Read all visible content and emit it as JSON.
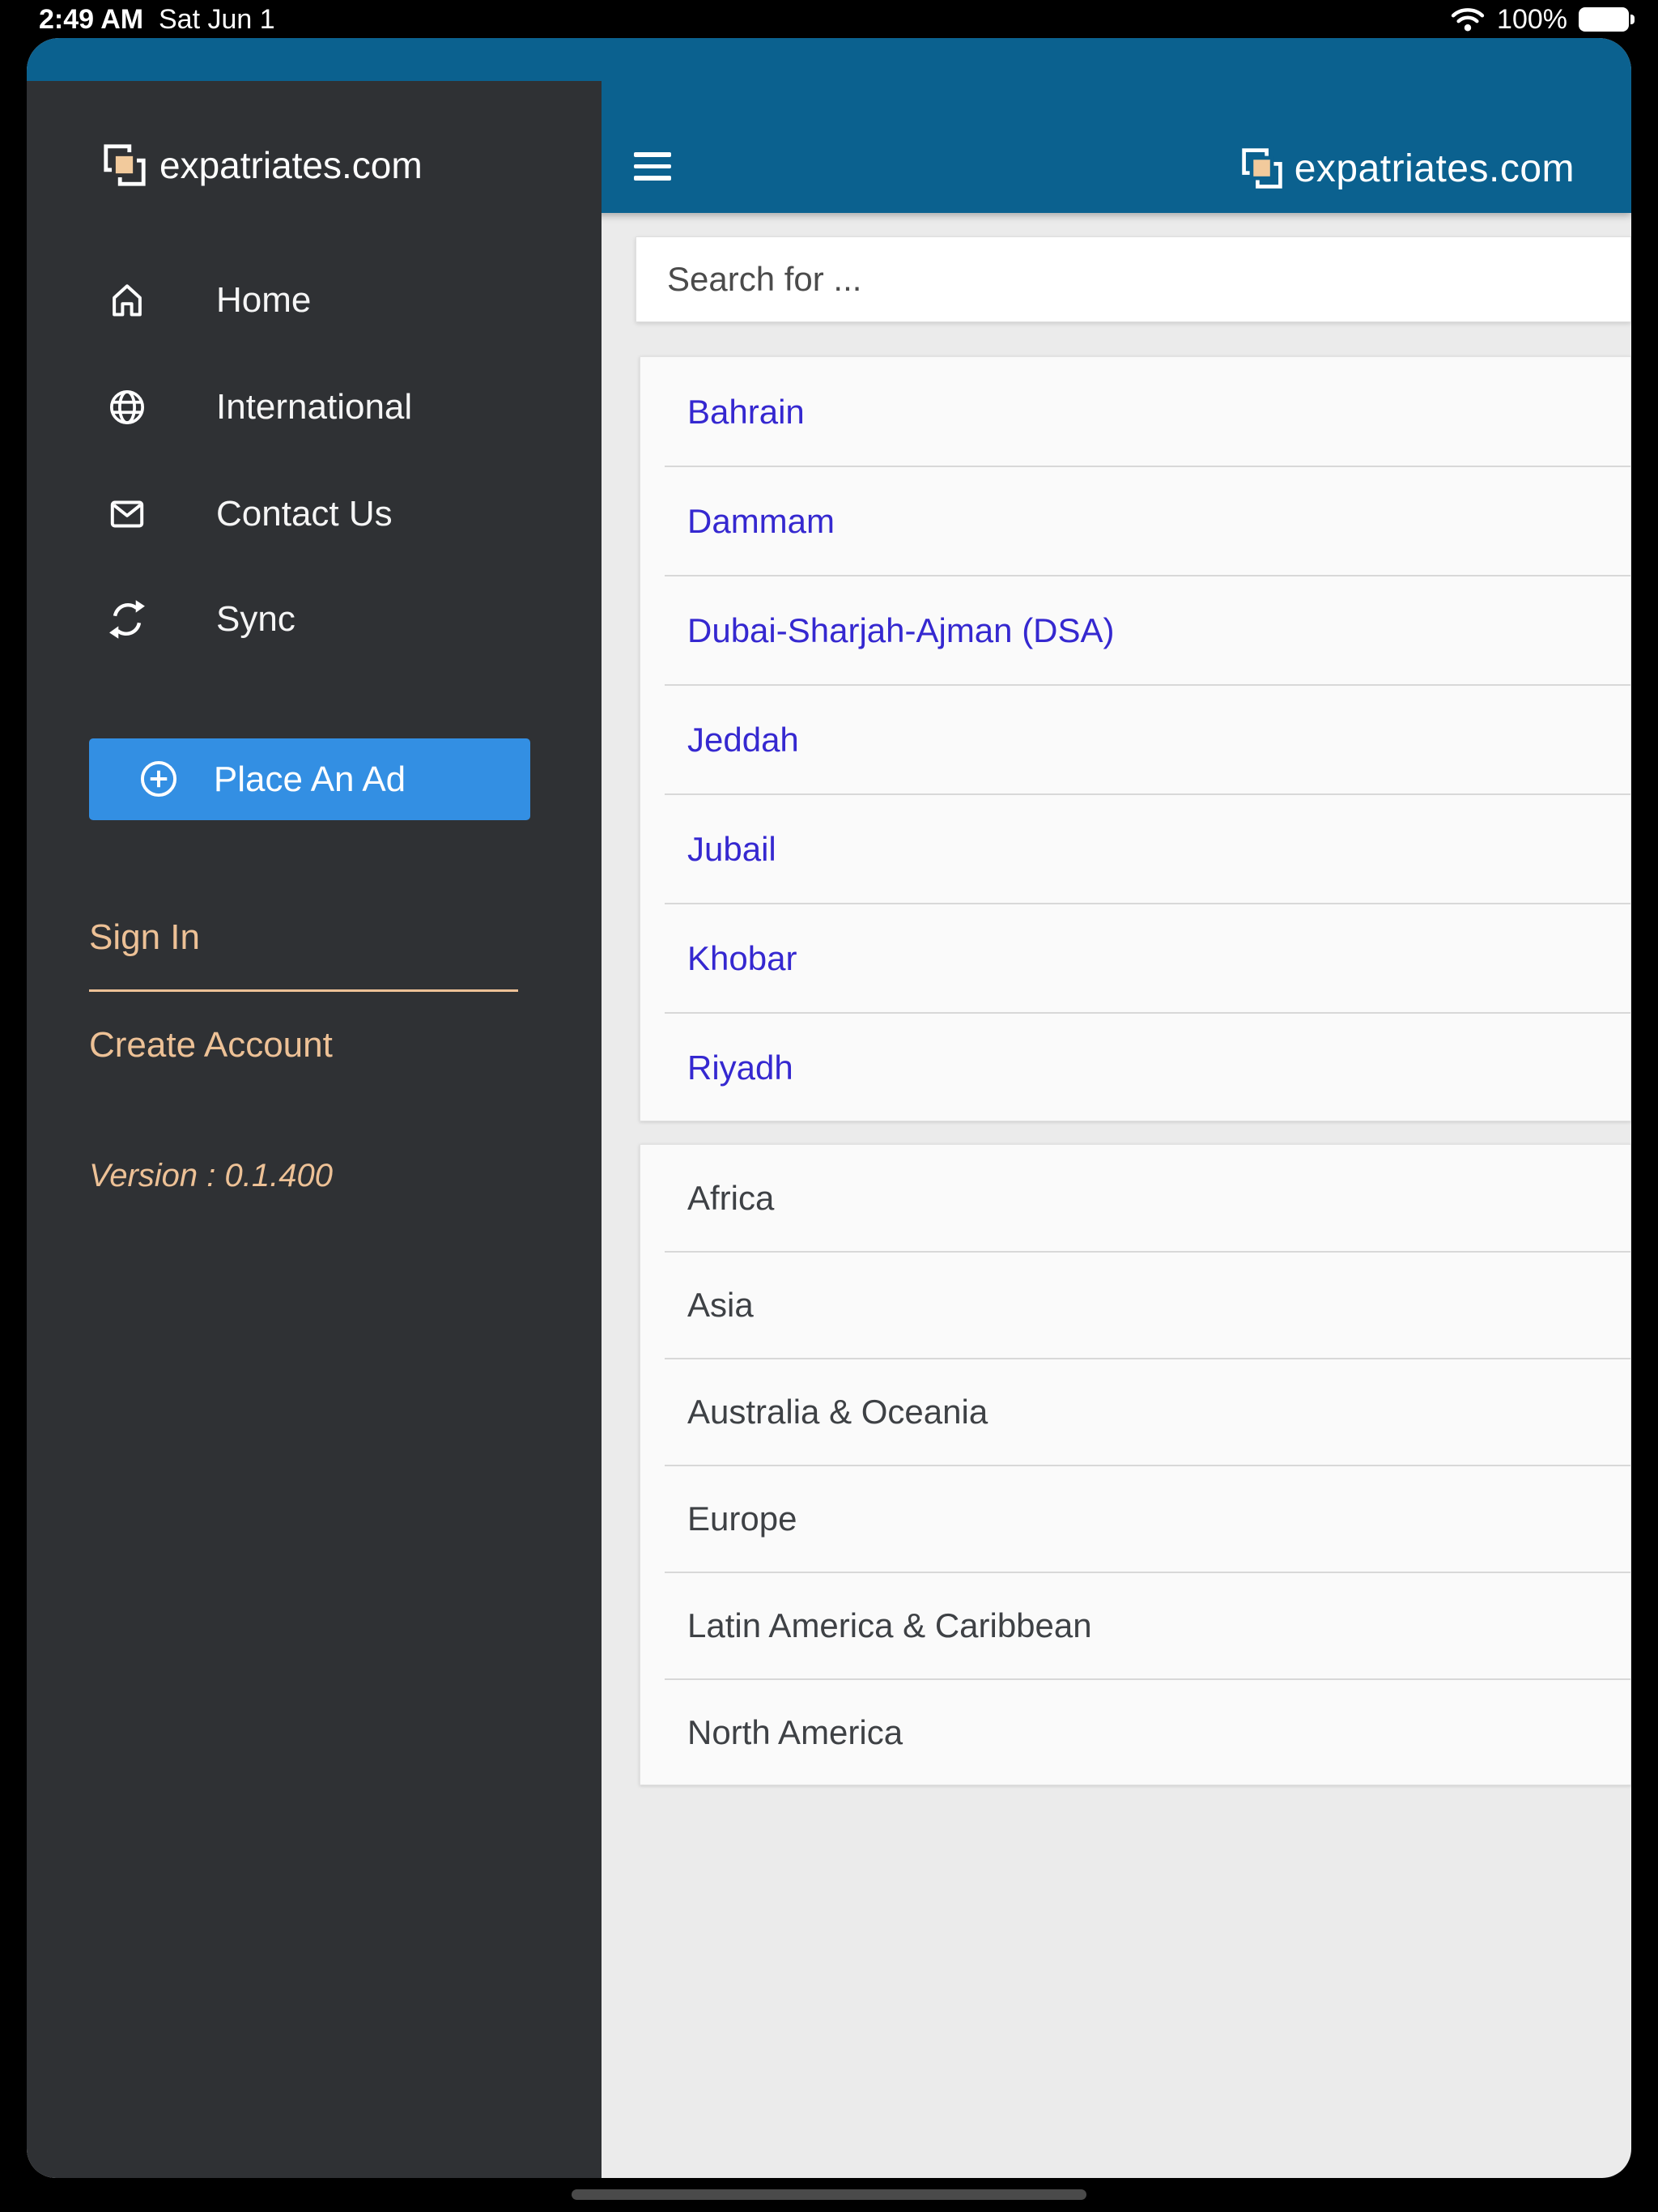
{
  "status_bar": {
    "time": "2:49 AM",
    "date": "Sat Jun 1",
    "battery_percent": "100%"
  },
  "app": {
    "header": {
      "brand": "expatriates.com"
    },
    "sidebar": {
      "brand": "expatriates.com",
      "menu": [
        {
          "icon": "home-icon",
          "label": "Home"
        },
        {
          "icon": "globe-icon",
          "label": "International"
        },
        {
          "icon": "mail-icon",
          "label": "Contact Us"
        },
        {
          "icon": "sync-icon",
          "label": "Sync"
        }
      ],
      "place_ad": "Place An Ad",
      "sign_in": "Sign In",
      "create_account": "Create Account",
      "version": "Version : 0.1.400"
    },
    "search": {
      "placeholder": "Search for ..."
    },
    "cities": [
      "Bahrain",
      "Dammam",
      "Dubai-Sharjah-Ajman (DSA)",
      "Jeddah",
      "Jubail",
      "Khobar",
      "Riyadh"
    ],
    "regions": [
      "Africa",
      "Asia",
      "Australia & Oceania",
      "Europe",
      "Latin America & Caribbean",
      "North America"
    ]
  },
  "colors": {
    "header_blue": "#0B618F",
    "sidebar_bg": "#2F3134",
    "accent_tan": "#EDC196",
    "button_blue": "#338FE3",
    "city_link_blue": "#3528D0",
    "region_text": "#3E4145"
  }
}
